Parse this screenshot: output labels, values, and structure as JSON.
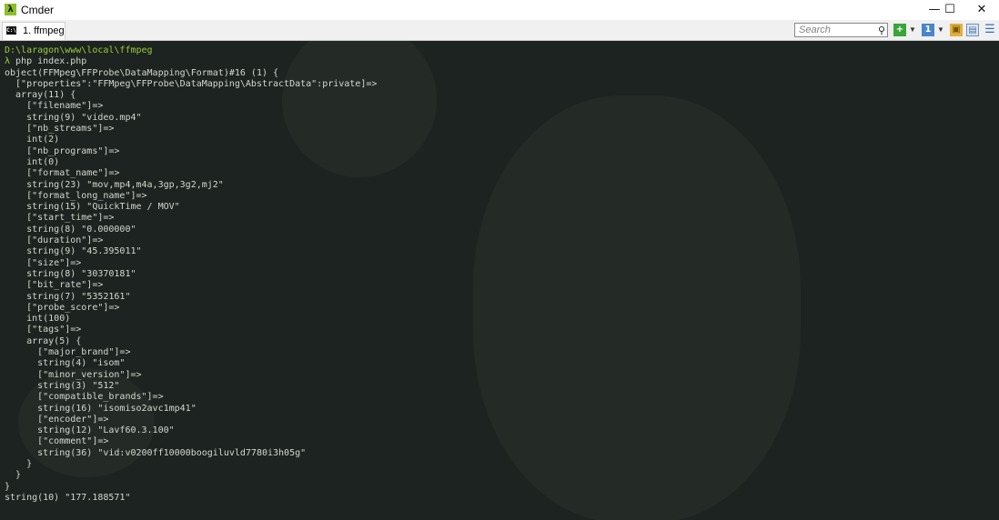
{
  "window": {
    "title": "Cmder",
    "controls": {
      "minimize": "—",
      "maximize": "☐",
      "close": "✕"
    }
  },
  "tabs": [
    {
      "label": "1. ffmpeg"
    }
  ],
  "search": {
    "placeholder": "Search"
  },
  "colors": {
    "console_bg": "#1d2320",
    "path": "#9acb3c",
    "prompt_symbol": "#9acb3c",
    "output_text": "#d3d7cf"
  },
  "console": {
    "lines": [
      {
        "text": "D:\\laragon\\www\\local\\ffmpeg",
        "kind": "path"
      },
      {
        "text": "λ php index.php",
        "kind": "prompt"
      },
      {
        "text": "object(FFMpeg\\FFProbe\\DataMapping\\Format)#16 (1) {",
        "kind": "out"
      },
      {
        "text": "  [\"properties\":\"FFMpeg\\FFProbe\\DataMapping\\AbstractData\":private]=>",
        "kind": "out"
      },
      {
        "text": "  array(11) {",
        "kind": "out"
      },
      {
        "text": "    [\"filename\"]=>",
        "kind": "out"
      },
      {
        "text": "    string(9) \"video.mp4\"",
        "kind": "out"
      },
      {
        "text": "    [\"nb_streams\"]=>",
        "kind": "out"
      },
      {
        "text": "    int(2)",
        "kind": "out"
      },
      {
        "text": "    [\"nb_programs\"]=>",
        "kind": "out"
      },
      {
        "text": "    int(0)",
        "kind": "out"
      },
      {
        "text": "    [\"format_name\"]=>",
        "kind": "out"
      },
      {
        "text": "    string(23) \"mov,mp4,m4a,3gp,3g2,mj2\"",
        "kind": "out"
      },
      {
        "text": "    [\"format_long_name\"]=>",
        "kind": "out"
      },
      {
        "text": "    string(15) \"QuickTime / MOV\"",
        "kind": "out"
      },
      {
        "text": "    [\"start_time\"]=>",
        "kind": "out"
      },
      {
        "text": "    string(8) \"0.000000\"",
        "kind": "out"
      },
      {
        "text": "    [\"duration\"]=>",
        "kind": "out"
      },
      {
        "text": "    string(9) \"45.395011\"",
        "kind": "out"
      },
      {
        "text": "    [\"size\"]=>",
        "kind": "out"
      },
      {
        "text": "    string(8) \"30370181\"",
        "kind": "out"
      },
      {
        "text": "    [\"bit_rate\"]=>",
        "kind": "out"
      },
      {
        "text": "    string(7) \"5352161\"",
        "kind": "out"
      },
      {
        "text": "    [\"probe_score\"]=>",
        "kind": "out"
      },
      {
        "text": "    int(100)",
        "kind": "out"
      },
      {
        "text": "    [\"tags\"]=>",
        "kind": "out"
      },
      {
        "text": "    array(5) {",
        "kind": "out"
      },
      {
        "text": "      [\"major_brand\"]=>",
        "kind": "out"
      },
      {
        "text": "      string(4) \"isom\"",
        "kind": "out"
      },
      {
        "text": "      [\"minor_version\"]=>",
        "kind": "out"
      },
      {
        "text": "      string(3) \"512\"",
        "kind": "out"
      },
      {
        "text": "      [\"compatible_brands\"]=>",
        "kind": "out"
      },
      {
        "text": "      string(16) \"isomiso2avc1mp41\"",
        "kind": "out"
      },
      {
        "text": "      [\"encoder\"]=>",
        "kind": "out"
      },
      {
        "text": "      string(12) \"Lavf60.3.100\"",
        "kind": "out"
      },
      {
        "text": "      [\"comment\"]=>",
        "kind": "out"
      },
      {
        "text": "      string(36) \"vid:v0200ff10000boogiluvld7780i3h05g\"",
        "kind": "out"
      },
      {
        "text": "    }",
        "kind": "out"
      },
      {
        "text": "  }",
        "kind": "out"
      },
      {
        "text": "}",
        "kind": "out"
      },
      {
        "text": "string(10) \"177.188571\"",
        "kind": "out"
      }
    ]
  }
}
